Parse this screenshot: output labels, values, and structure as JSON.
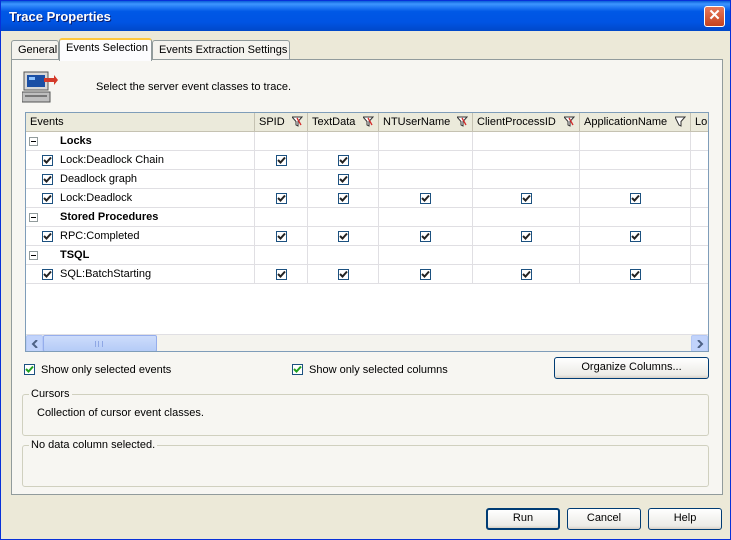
{
  "window": {
    "title": "Trace Properties"
  },
  "tabs": [
    {
      "label": "General",
      "active": false
    },
    {
      "label": "Events Selection",
      "active": true
    },
    {
      "label": "Events Extraction Settings",
      "active": false
    }
  ],
  "header": {
    "instruction": "Select the server event classes to trace."
  },
  "grid": {
    "columns": [
      "Events",
      "SPID",
      "TextData",
      "NTUserName",
      "ClientProcessID",
      "ApplicationName",
      "Lo"
    ],
    "rows": [
      {
        "type": "category",
        "label": "Locks"
      },
      {
        "type": "event",
        "label": "Lock:Deadlock Chain",
        "checked": true,
        "cols": [
          true,
          true,
          false,
          false,
          false
        ]
      },
      {
        "type": "event",
        "label": "Deadlock graph",
        "checked": true,
        "cols": [
          false,
          true,
          false,
          false,
          false
        ]
      },
      {
        "type": "event",
        "label": "Lock:Deadlock",
        "checked": true,
        "cols": [
          true,
          true,
          true,
          true,
          true
        ]
      },
      {
        "type": "category",
        "label": "Stored Procedures"
      },
      {
        "type": "event",
        "label": "RPC:Completed",
        "checked": true,
        "cols": [
          true,
          true,
          true,
          true,
          true
        ]
      },
      {
        "type": "category",
        "label": "TSQL"
      },
      {
        "type": "event",
        "label": "SQL:BatchStarting",
        "checked": true,
        "cols": [
          true,
          true,
          true,
          true,
          true
        ]
      }
    ]
  },
  "options": {
    "show_selected_events": "Show only selected events",
    "show_selected_columns": "Show only selected columns",
    "organize_columns": "Organize Columns..."
  },
  "cursors_group": {
    "title": "Cursors",
    "description": "Collection of cursor event classes."
  },
  "column_group": {
    "title": "No data column selected."
  },
  "buttons": {
    "run": "Run",
    "cancel": "Cancel",
    "help": "Help"
  },
  "colors": {
    "accent": "#0054e3",
    "window_bg": "#ece9d8",
    "check": "#21a121"
  }
}
